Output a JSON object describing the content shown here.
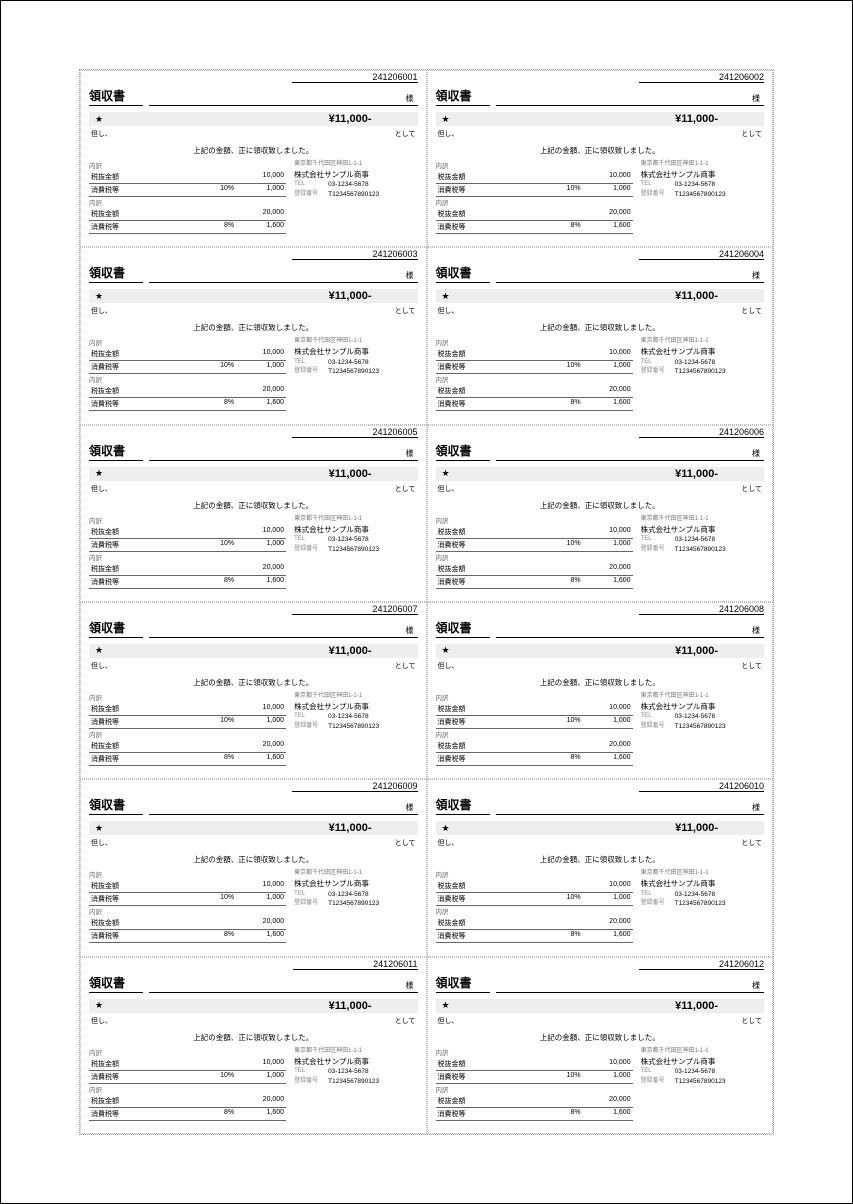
{
  "labels": {
    "title": "領収書",
    "honorific": "様",
    "star": "★",
    "amount": "¥11,000-",
    "provided": "但し、",
    "as": "として",
    "confirm": "上記の金額、正に領収致しました。",
    "breakdown_header": "内訳",
    "row1_label": "税抜金額",
    "row1_val": "10,000",
    "row2_label": "消費税等",
    "row2_rate": "10%",
    "row2_val": "1,000",
    "row3_label": "税抜金額",
    "row3_val": "20,000",
    "row4_label": "消費税等",
    "row4_rate": "8%",
    "row4_val": "1,600",
    "issuer_addr": "東京都千代田区神田1-1-1",
    "issuer_name": "株式会社サンプル商事",
    "tel_label": "TEL",
    "tel": "03-1234-5678",
    "reg_label": "登録番号",
    "reg": "T1234567890123"
  },
  "receipts": [
    {
      "num": "241206001"
    },
    {
      "num": "241206002"
    },
    {
      "num": "241206003"
    },
    {
      "num": "241206004"
    },
    {
      "num": "241206005"
    },
    {
      "num": "241206006"
    },
    {
      "num": "241206007"
    },
    {
      "num": "241206008"
    },
    {
      "num": "241206009"
    },
    {
      "num": "241206010"
    },
    {
      "num": "241206011"
    },
    {
      "num": "241206012"
    }
  ]
}
